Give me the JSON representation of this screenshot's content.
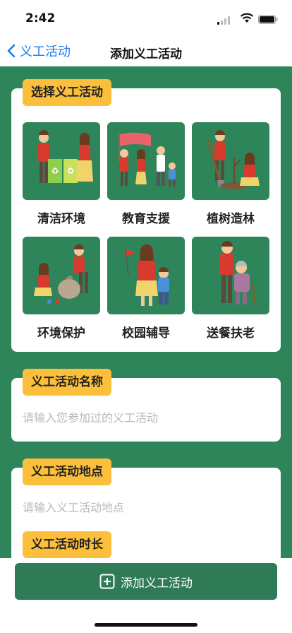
{
  "status_bar": {
    "time": "2:42"
  },
  "nav": {
    "back_label": "义工活动",
    "title": "添加义工活动"
  },
  "select_section": {
    "tag": "选择义工活动",
    "activities": [
      {
        "label": "清洁环境",
        "icon": "recycling-illustration"
      },
      {
        "label": "教育支援",
        "icon": "education-illustration"
      },
      {
        "label": "植树造林",
        "icon": "tree-planting-illustration"
      },
      {
        "label": "环境保护",
        "icon": "litter-pickup-illustration"
      },
      {
        "label": "校园辅导",
        "icon": "campus-flag-illustration"
      },
      {
        "label": "送餐扶老",
        "icon": "elderly-care-illustration"
      }
    ]
  },
  "name_section": {
    "tag": "义工活动名称",
    "placeholder": "请输入您参加过的义工活动"
  },
  "location_section": {
    "tag": "义工活动地点",
    "placeholder": "请输入义工活动地点"
  },
  "duration_section": {
    "tag": "义工活动时长"
  },
  "add_button": {
    "label": "添加义工活动"
  },
  "colors": {
    "green": "#2f855a",
    "accent_yellow": "#fbbf3c",
    "link_blue": "#1e7cf2"
  }
}
